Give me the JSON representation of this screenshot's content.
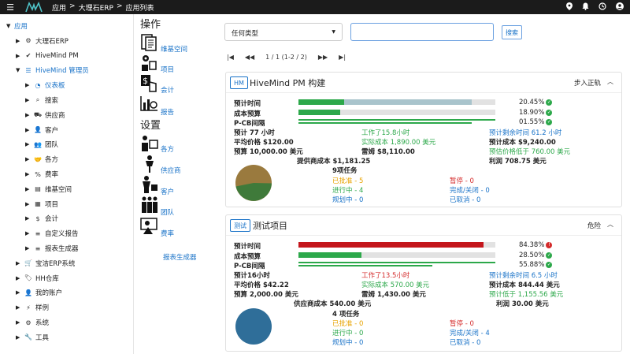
{
  "topbar": {
    "breadcrumb": [
      "应用",
      ">",
      "大理石ERP",
      ">",
      "应用列表"
    ]
  },
  "sidebar": {
    "items": [
      {
        "label": "应用",
        "level": 0,
        "icon": "",
        "expanded": true
      },
      {
        "label": "大理石ERP",
        "level": 1,
        "icon": "gears-icon"
      },
      {
        "label": "HiveMind PM",
        "level": 1,
        "icon": "check-icon"
      },
      {
        "label": "HiveMind 管理员",
        "level": 1,
        "icon": "list-icon",
        "expanded": true,
        "active": true
      },
      {
        "label": "仪表板",
        "level": 2,
        "icon": "dashboard-icon",
        "active": true
      },
      {
        "label": "搜索",
        "level": 2,
        "icon": "search-icon"
      },
      {
        "label": "供应商",
        "level": 2,
        "icon": "truck-icon"
      },
      {
        "label": "客户",
        "level": 2,
        "icon": "user-tie-icon"
      },
      {
        "label": "团队",
        "level": 2,
        "icon": "users-icon"
      },
      {
        "label": "各方",
        "level": 2,
        "icon": "handshake-icon"
      },
      {
        "label": "费率",
        "level": 2,
        "icon": "rate-icon"
      },
      {
        "label": "维基空间",
        "level": 2,
        "icon": "book-icon"
      },
      {
        "label": "项目",
        "level": 2,
        "icon": "project-icon"
      },
      {
        "label": "会计",
        "level": 2,
        "icon": "accounting-icon"
      },
      {
        "label": "自定义报告",
        "level": 2,
        "icon": "database-icon"
      },
      {
        "label": "报表生成器",
        "level": 2,
        "icon": "database-icon"
      },
      {
        "label": "宝洁ERP系统",
        "level": 1,
        "icon": "cart-icon"
      },
      {
        "label": "HH仓库",
        "level": 1,
        "icon": "tag-icon"
      },
      {
        "label": "我的账户",
        "level": 1,
        "icon": "user-icon"
      },
      {
        "label": "样例",
        "level": 1,
        "icon": "bolt-icon"
      },
      {
        "label": "系统",
        "level": 1,
        "icon": "gear-icon"
      },
      {
        "label": "工具",
        "level": 1,
        "icon": "wrench-icon"
      }
    ]
  },
  "ops": {
    "title": "操作",
    "wiki": "维基空间",
    "project": "项目",
    "accounting": "会计",
    "report": "报告"
  },
  "settings": {
    "title": "设置",
    "parties": "各方",
    "vendors": "供应商",
    "customers": "客户",
    "teams": "团队",
    "rates": "费率",
    "report_builder": "报表生成器"
  },
  "filter": {
    "label": "任何类型",
    "search_btn": "搜索"
  },
  "pager": {
    "text": "1 / 1 (1-2 / 2)"
  },
  "cards": [
    {
      "tag": "HM",
      "title": "HiveMind PM 构建",
      "status": "步入正轨",
      "rows": [
        {
          "label": "预计时间",
          "pct": "20.45%",
          "ok": true
        },
        {
          "label": "成本预算",
          "pct": "18.90%",
          "ok": true
        },
        {
          "label": "P-CB间隔",
          "pct": "01.55%",
          "ok": true
        }
      ],
      "est": "预计 77 小时",
      "worked": "工作了15.8小时",
      "remain": "预计剩余时间 61.2 小时",
      "avg": "平均价格 $120.00",
      "actual": "实际成本 1,890.00 美元",
      "estcost": "预计成本 $9,240.00",
      "budget": "预算 10,000.00 美元",
      "leimu": "雷姆 $8,110.00",
      "under": "预估价格低于 760.00 美元",
      "vendorcost": "提供商成本 $1,181.25",
      "profit": "利润 708.75 美元",
      "tasks": "9项任务",
      "approved": "已批准 - 5",
      "progress": "进行中 - 4",
      "planned": "规划中 - 0",
      "paused": "暂停 - 0",
      "done": "完成/关闭 - 0",
      "cancelled": "已取消 - 0"
    },
    {
      "tag": "测试",
      "title": "测试项目",
      "status": "危险",
      "rows": [
        {
          "label": "预计时间",
          "pct": "84.38%",
          "ok": false
        },
        {
          "label": "成本预算",
          "pct": "28.50%",
          "ok": true
        },
        {
          "label": "P-CB间隔",
          "pct": "55.88%",
          "ok": true
        }
      ],
      "est": "预计16小时",
      "worked": "工作了13.5小时",
      "remain": "预计剩余时间 6.5 小时",
      "avg": "平均价格 $42.22",
      "actual": "实际成本 570.00 美元",
      "estcost": "预计成本 844.44 美元",
      "budget": "预算 2,000.00 美元",
      "leimu": "雷姆 1,430.00 美元",
      "under": "预计低于 1,155.56 美元",
      "vendorcost": "供应商成本 540.00 美元",
      "profit": "利润 30.00 美元",
      "tasks": "4 项任务",
      "approved": "已批准 - 0",
      "progress": "进行中 - 0",
      "planned": "规划中 - 0",
      "paused": "暂停 - 0",
      "done": "完成/关闭 - 4",
      "cancelled": "已取消 - 0"
    }
  ],
  "colors": {
    "accent": "#1a73c8",
    "green": "#2ca84a",
    "red": "#c4161c",
    "topbar": "#1b1b1b",
    "pie1_a": "#9a7a3e",
    "pie1_b": "#3f7a3a",
    "pie2": "#2f6e99"
  }
}
